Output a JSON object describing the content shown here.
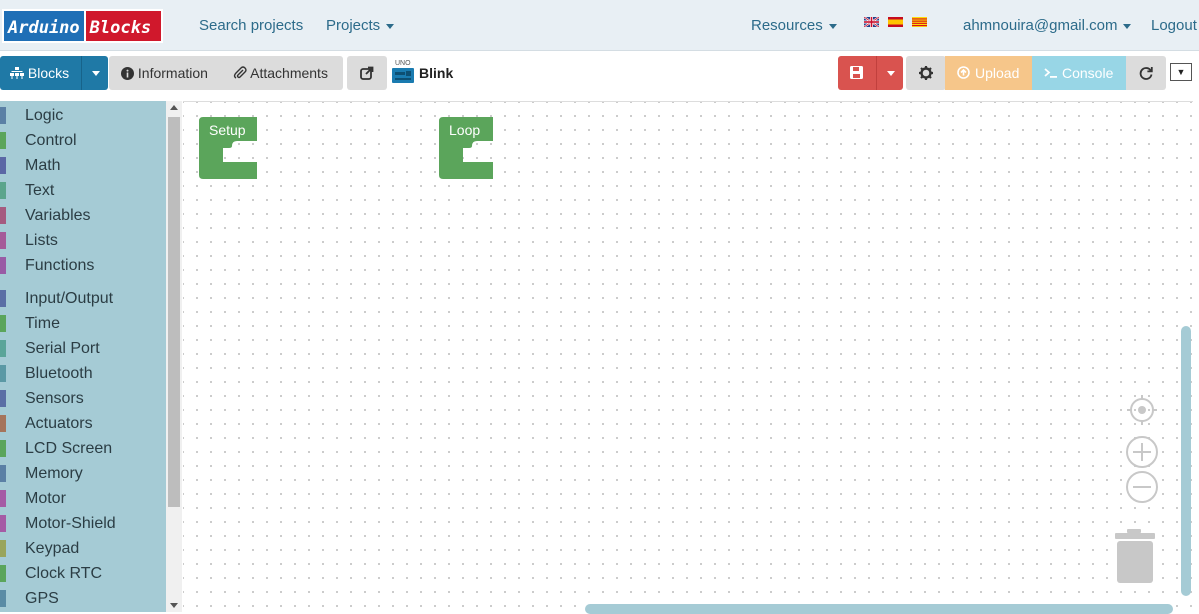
{
  "navbar": {
    "logo_part1": "Arduino",
    "logo_part2": "Blocks",
    "search_projects": "Search projects",
    "projects": "Projects",
    "resources": "Resources",
    "user_email": "ahmnouira@gmail.com",
    "logout": "Logout"
  },
  "toolbar": {
    "blocks_label": "Blocks",
    "information_label": "Information",
    "attachments_label": "Attachments",
    "board_tag": "UNO",
    "project_name": "Blink",
    "upload_label": "Upload",
    "console_label": "Console",
    "dropdown_label": "▼"
  },
  "sidebar": {
    "categories": [
      {
        "name": "Logic",
        "color": "#5b80a5"
      },
      {
        "name": "Control",
        "color": "#5ba55b"
      },
      {
        "name": "Math",
        "color": "#5b67a5"
      },
      {
        "name": "Text",
        "color": "#5ba58c"
      },
      {
        "name": "Variables",
        "color": "#a55b80"
      },
      {
        "name": "Lists",
        "color": "#a55b99"
      },
      {
        "name": "Functions",
        "color": "#995ba5"
      },
      {
        "name": "Input/Output",
        "color": "#5b6fa5"
      },
      {
        "name": "Time",
        "color": "#5ba55b"
      },
      {
        "name": "Serial Port",
        "color": "#5ba599"
      },
      {
        "name": "Bluetooth",
        "color": "#5b99a5"
      },
      {
        "name": "Sensors",
        "color": "#5b6fa5"
      },
      {
        "name": "Actuators",
        "color": "#a5745b"
      },
      {
        "name": "LCD Screen",
        "color": "#5ba55b"
      },
      {
        "name": "Memory",
        "color": "#5b80a5"
      },
      {
        "name": "Motor",
        "color": "#a55ba5"
      },
      {
        "name": "Motor-Shield",
        "color": "#a55ba5"
      },
      {
        "name": "Keypad",
        "color": "#99a55b"
      },
      {
        "name": "Clock RTC",
        "color": "#5ba55b"
      },
      {
        "name": "GPS",
        "color": "#5b8ca5"
      }
    ]
  },
  "workspace": {
    "setup_block": "Setup",
    "loop_block": "Loop",
    "block_color": "#5ba55b"
  },
  "colors": {
    "primary": "#1f79a6",
    "danger": "#d9534f",
    "warning": "#f6c68a",
    "info": "#98d6e6",
    "sidebar_bg": "#a5cbd5"
  }
}
